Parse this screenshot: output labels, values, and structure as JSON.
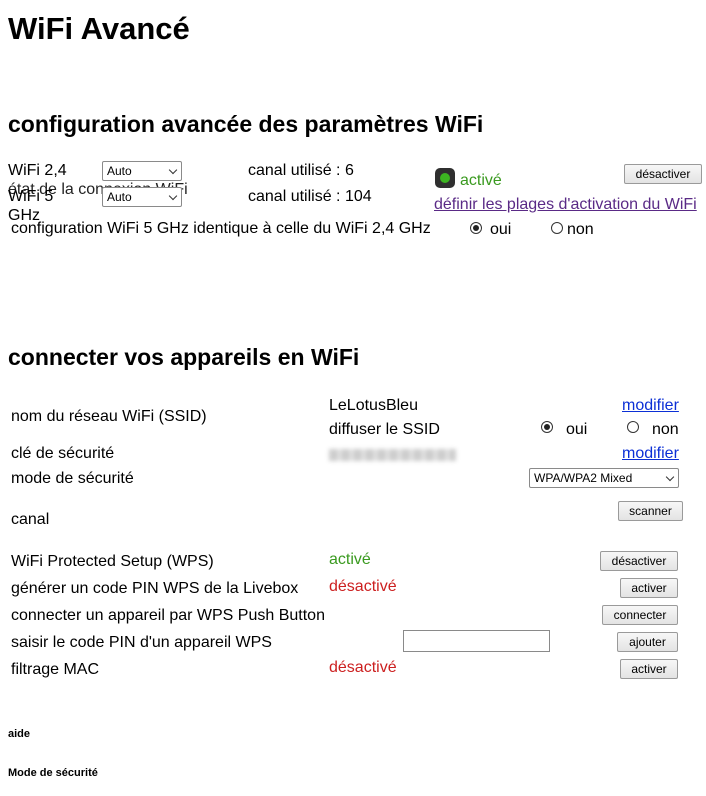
{
  "page_title": "WiFi Avancé",
  "advanced": {
    "heading": "configuration avancée des paramètres WiFi",
    "wifi24_label": "WiFi 2,4",
    "wifi24_select": "Auto",
    "wifi24_channel": "canal utilisé : 6",
    "wifi5_label": "WiFi 5",
    "wifi5_label_line2": "GHz",
    "wifi5_select": "Auto",
    "wifi5_channel": "canal utilisé : 104",
    "overlap_text": "état de la connexion WiFi",
    "status_text": "activé",
    "deactivate_button": "désactiver",
    "schedule_link": "définir les plages d'activation du WiFi",
    "identical_label": "configuration WiFi 5 GHz identique à celle du WiFi 2,4 GHz",
    "identical_yes": "oui",
    "identical_no": "non",
    "identical_selected": "oui"
  },
  "connect": {
    "heading": "connecter vos appareils en WiFi",
    "ssid_label": "nom du réseau WiFi (SSID)",
    "ssid_value": "LeLotusBleu",
    "ssid_modify": "modifier",
    "broadcast_label": "diffuser le SSID",
    "broadcast_yes": "oui",
    "broadcast_no": "non",
    "broadcast_selected": "oui",
    "key_label": "clé de sécurité",
    "key_modify": "modifier",
    "mode_label": "mode de sécurité",
    "mode_select": "WPA/WPA2 Mixed",
    "channel_label": "canal",
    "scan_button": "scanner",
    "wps_label": "WiFi Protected Setup (WPS)",
    "wps_status": "activé",
    "wps_button": "désactiver",
    "pin_label": "générer un code PIN WPS de la Livebox",
    "pin_status": "désactivé",
    "pin_button": "activer",
    "push_label": "connecter un appareil par WPS Push Button",
    "push_button": "connecter",
    "enter_pin_label": "saisir le code PIN d'un appareil WPS",
    "enter_pin_value": "",
    "enter_pin_button": "ajouter",
    "mac_label": "filtrage MAC",
    "mac_status": "désactivé",
    "mac_button": "activer"
  },
  "footer": {
    "help_label": "aide",
    "security_mode_label": "Mode de sécurité"
  },
  "colors": {
    "active_green": "#3a9a1f",
    "inactive_red": "#cc1f1f",
    "link_blue": "#0b2fd6",
    "link_purple": "#5a2a86"
  },
  "icons": {
    "status_led": "green-led-icon",
    "dropdown": "chevron-down-icon"
  }
}
